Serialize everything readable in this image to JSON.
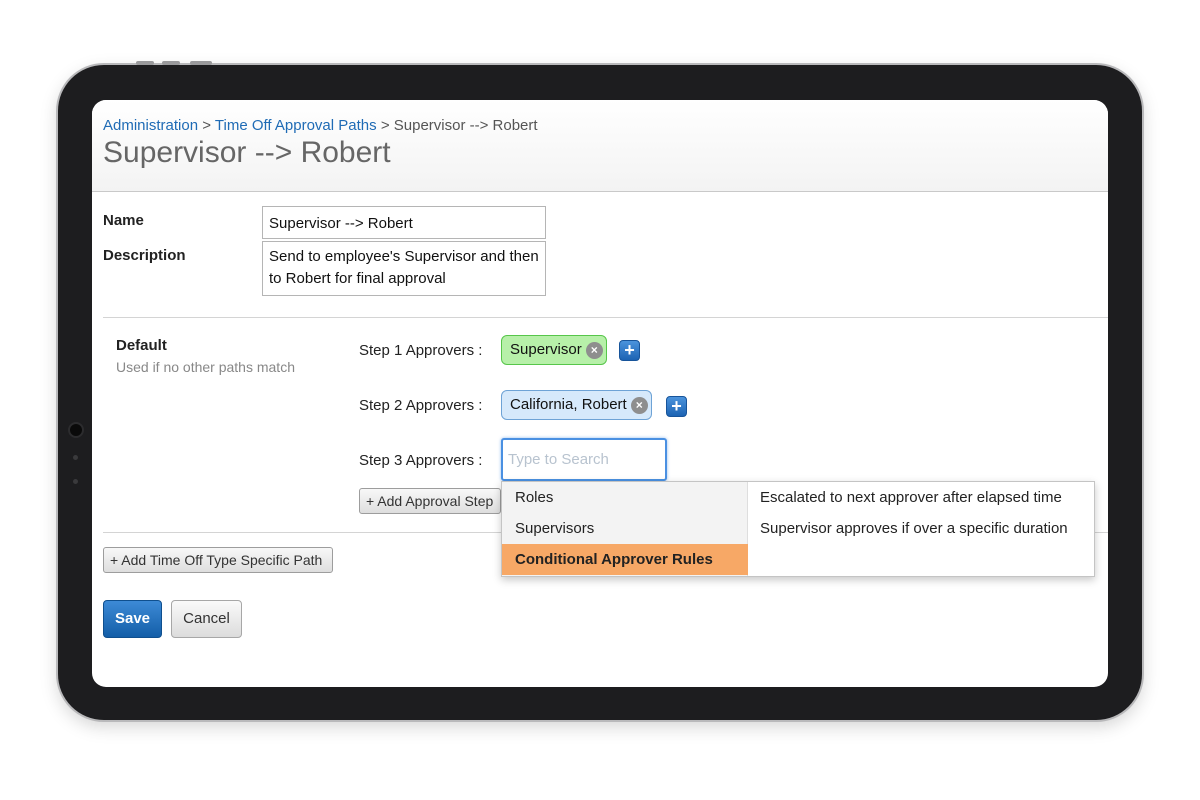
{
  "breadcrumb": {
    "items": [
      "Administration",
      "Time Off Approval Paths"
    ],
    "separator": ">",
    "current": "Supervisor --> Robert"
  },
  "page_title": "Supervisor --> Robert",
  "form": {
    "name_label": "Name",
    "name_value": "Supervisor --> Robert",
    "description_label": "Description",
    "description_value": "Send to employee's Supervisor and then to Robert for final approval"
  },
  "default_path": {
    "title": "Default",
    "subtitle": "Used if no other paths match"
  },
  "steps": [
    {
      "label": "Step 1 Approvers :",
      "chip": "Supervisor",
      "chip_color": "#b7f0a9"
    },
    {
      "label": "Step 2 Approvers :",
      "chip": "California, Robert",
      "chip_color": "#d6e9fb"
    },
    {
      "label": "Step 3 Approvers :",
      "placeholder": "Type to Search"
    }
  ],
  "add_step_label": "+ Add Approval Step",
  "add_path_label": "+ Add Time Off Type Specific Path",
  "dropdown": {
    "categories": [
      "Roles",
      "Supervisors",
      "Conditional Approver Rules"
    ],
    "active_category": "Conditional Approver Rules",
    "options": [
      "Escalated to next approver after elapsed time",
      "Supervisor approves if over a specific duration"
    ]
  },
  "actions": {
    "save": "Save",
    "cancel": "Cancel"
  },
  "icons": {
    "remove": "remove-chip-icon",
    "add": "plus-icon"
  },
  "colors": {
    "link": "#1f6bb5",
    "primary": "#1f6bb5",
    "highlight": "#f7a866"
  }
}
